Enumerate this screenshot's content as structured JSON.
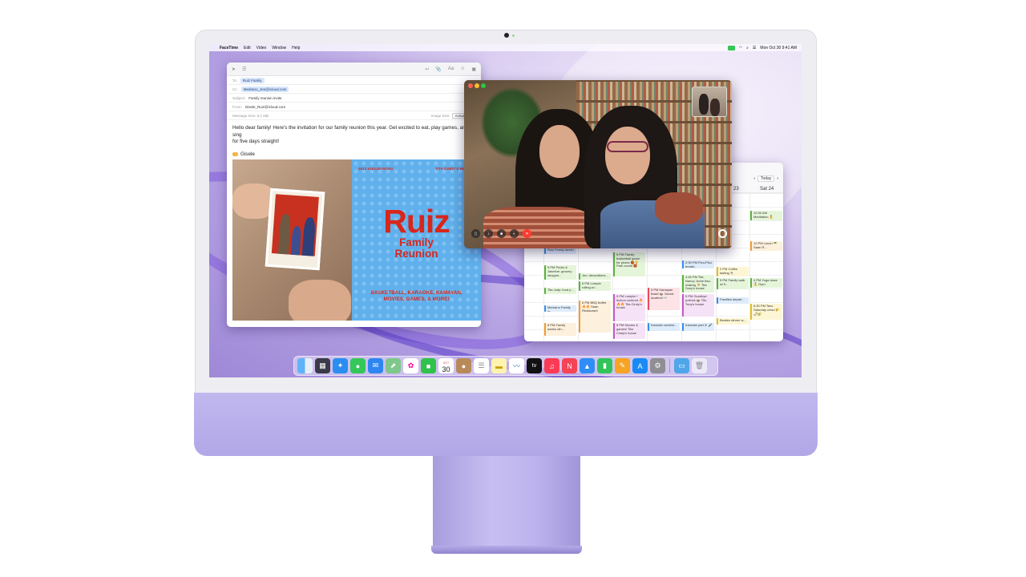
{
  "menubar": {
    "app": "FaceTime",
    "items": [
      "Edit",
      "Video",
      "Window",
      "Help"
    ],
    "clock": "Mon Oct 30  9:41 AM"
  },
  "mail": {
    "to_label": "To:",
    "to_value": "Ruiz Family",
    "cc_label": "Cc:",
    "cc_value": "Medrano_Jen@icloud.com",
    "subject_label": "Subject:",
    "subject_value": "Family reunion invite",
    "from_label": "From:",
    "from_value": "Gisele_Ruiz@icloud.com",
    "message_size": "Message Size: 5.1 MB",
    "image_size_label": "Image Size:",
    "image_size_value": "Actual Size",
    "body_line1": "Hello dear family! Here's the invitation for our family reunion this year. Get excited to eat, play games, and sing",
    "body_line2": "for five days straight!",
    "signature": "Gisele",
    "invite": {
      "address": "4513 KUULEI ROAD",
      "host": "TITA CINDY'S HOUSE",
      "title": "Ruiz",
      "subtitle1": "Family",
      "subtitle2": "Reunion",
      "activities": "BASKETBALL, KARAOKE, KAMAYAN, MOVIES, GAMES, & MORE!"
    }
  },
  "calendar": {
    "today_label": "Today",
    "day23": "23",
    "day24": "Sat 24",
    "times": [
      "",
      "",
      "",
      "",
      "",
      "",
      "",
      "",
      "",
      ""
    ],
    "events": [
      {
        "t": "Ruiz Family lands!",
        "c": "b"
      },
      {
        "t": "5 PM Pedro & Jasmine: grocery shoppin...",
        "c": "g"
      },
      {
        "t": "Tita Judy: food p...",
        "c": "g"
      },
      {
        "t": "Medrano Family la...",
        "c": "b"
      },
      {
        "t": "8 PM Family adobo din...",
        "c": "o"
      },
      {
        "t": "Jen: decorations...",
        "c": "g"
      },
      {
        "t": "6 PM Lumpia rolling w/...",
        "c": "g"
      },
      {
        "t": "6 PM BBQ buffet 🔥🔥 Saan Restaurant",
        "c": "o"
      },
      {
        "t": "9 PM Family basketball game for prizes 🏀🏆 Park courts 🏀",
        "c": "g"
      },
      {
        "t": "5 PM Lumpia + lechon cookout 🔥🔥🔥 Tita Cindy's house",
        "c": "p"
      },
      {
        "t": "8 PM Movies & games! Tita Cindy's house",
        "c": "p"
      },
      {
        "t": "5 PM Kamayan feast! 🍲 Secret location! 👀",
        "c": "r"
      },
      {
        "t": "Karaoke contest...",
        "c": "b"
      },
      {
        "t": "2:30 PM Pico-Pico breaki...",
        "c": "b"
      },
      {
        "t": "4:45 PM Tita Nancy: leche flan-making 🍮 Tita Sony's house",
        "c": "g"
      },
      {
        "t": "5 PM Goodbye potluck 🍲 Tito Tony's house",
        "c": "p"
      },
      {
        "t": "Karaoke part 2! 🎤",
        "c": "b"
      },
      {
        "t": "2 PM Coffee tasting ☕",
        "c": "y"
      },
      {
        "t": "5 PM Family walk w/ fi...",
        "c": "g"
      },
      {
        "t": "Families depart...",
        "c": "b"
      },
      {
        "t": "Besties dinner w...",
        "c": "y"
      },
      {
        "t": "10:30 AM Meditation 🧘",
        "c": "g"
      },
      {
        "t": "12 PM Lunch 🥗 Saan R...",
        "c": "o"
      },
      {
        "t": "4 PM Yoga class 🧘 Gym",
        "c": "g"
      },
      {
        "t": "6:30 PM Taco Saturday crew! 🌮🌶🥑",
        "c": "y"
      }
    ]
  },
  "dock": {
    "cal_month": "OCT",
    "cal_day": "30",
    "tv_label": "tv"
  },
  "colors": {
    "accent": "#d8261b",
    "poster_blue": "#5fb0ec",
    "chassis": "#b8aeea",
    "facetime_green": "#34c759"
  }
}
